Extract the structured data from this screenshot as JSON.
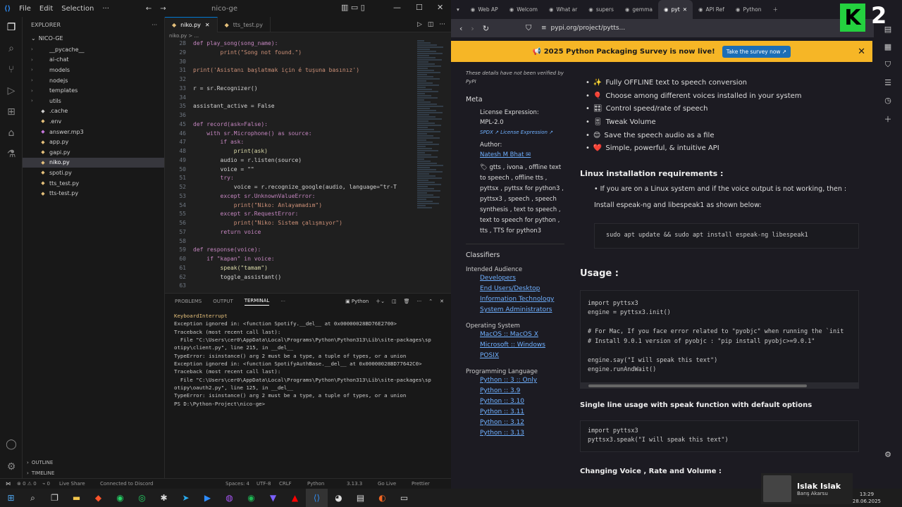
{
  "vscode": {
    "menu": [
      "File",
      "Edit",
      "Selection"
    ],
    "title": "nico-ge",
    "explorer_label": "EXPLORER",
    "folder": "NICO-GE",
    "files": [
      {
        "name": "__pycache__",
        "type": "folder",
        "color": "#ccc"
      },
      {
        "name": "ai-chat",
        "type": "folder",
        "color": "#ccc"
      },
      {
        "name": "models",
        "type": "folder",
        "color": "#ccc"
      },
      {
        "name": "nodejs",
        "type": "folder",
        "color": "#ccc"
      },
      {
        "name": "templates",
        "type": "folder",
        "color": "#ccc"
      },
      {
        "name": "utils",
        "type": "folder",
        "color": "#ccc"
      },
      {
        "name": ".cache",
        "type": "file",
        "color": "#ccc"
      },
      {
        "name": ".env",
        "type": "file",
        "color": "#e5c07b"
      },
      {
        "name": "answer.mp3",
        "type": "file",
        "color": "#c678dd"
      },
      {
        "name": "app.py",
        "type": "file",
        "color": "#e5c07b"
      },
      {
        "name": "gapi.py",
        "type": "file",
        "color": "#e5c07b"
      },
      {
        "name": "niko.py",
        "type": "file",
        "color": "#e5c07b",
        "selected": true
      },
      {
        "name": "spoti.py",
        "type": "file",
        "color": "#e5c07b"
      },
      {
        "name": "tts_test.py",
        "type": "file",
        "color": "#e5c07b"
      },
      {
        "name": "tts-test.py",
        "type": "file",
        "color": "#e5c07b"
      }
    ],
    "outline": "OUTLINE",
    "timeline": "TIMELINE",
    "tabs": [
      {
        "label": "niko.py",
        "active": true
      },
      {
        "label": "tts_test.py",
        "active": false
      }
    ],
    "breadcrumb": "niko.py > ...",
    "code": [
      {
        "n": "28",
        "t": "def play_song(song_name):"
      },
      {
        "n": "29",
        "t": "        print(\"Song not found.\")"
      },
      {
        "n": "30",
        "t": ""
      },
      {
        "n": "31",
        "t": "print('Asistanı başlatmak için é tuşuna basınız')"
      },
      {
        "n": "32",
        "t": ""
      },
      {
        "n": "33",
        "t": "r = sr.Recognizer()"
      },
      {
        "n": "34",
        "t": ""
      },
      {
        "n": "35",
        "t": "assistant_active = False"
      },
      {
        "n": "36",
        "t": ""
      },
      {
        "n": "45",
        "t": "def record(ask=False):"
      },
      {
        "n": "46",
        "t": "    with sr.Microphone() as source:"
      },
      {
        "n": "47",
        "t": "        if ask:"
      },
      {
        "n": "48",
        "t": "            print(ask)"
      },
      {
        "n": "49",
        "t": "        audio = r.listen(source)"
      },
      {
        "n": "50",
        "t": "        voice = \"\""
      },
      {
        "n": "51",
        "t": "        try:"
      },
      {
        "n": "52",
        "t": "            voice = r.recognize_google(audio, language=\"tr-T"
      },
      {
        "n": "53",
        "t": "        except sr.UnknownValueError:"
      },
      {
        "n": "54",
        "t": "            print(\"Niko: Anlayamadım\")"
      },
      {
        "n": "55",
        "t": "        except sr.RequestError:"
      },
      {
        "n": "56",
        "t": "            print(\"Niko: Sistem çalışmıyor\")"
      },
      {
        "n": "57",
        "t": "        return voice"
      },
      {
        "n": "58",
        "t": ""
      },
      {
        "n": "59",
        "t": "def response(voice):"
      },
      {
        "n": "60",
        "t": "    if \"kapan\" in voice:"
      },
      {
        "n": "61",
        "t": "        speak(\"tamam\")"
      },
      {
        "n": "62",
        "t": "        toggle_assistant()"
      },
      {
        "n": "63",
        "t": ""
      }
    ],
    "panel_tabs": [
      "PROBLEMS",
      "OUTPUT",
      "TERMINAL"
    ],
    "panel_right": "Python",
    "terminal": [
      {
        "t": "KeyboardInterrupt",
        "c": "yellow"
      },
      {
        "t": "Exception ignored in: <function Spotify.__del__ at 0x00000028BD76E2700>"
      },
      {
        "t": "Traceback (most recent call last):"
      },
      {
        "t": "  File \"C:\\Users\\cer0\\AppData\\Local\\Programs\\Python\\Python313\\Lib\\site-packages\\sp"
      },
      {
        "t": "otipy\\client.py\", line 215, in __del__"
      },
      {
        "t": "TypeError: isinstance() arg 2 must be a type, a tuple of types, or a union"
      },
      {
        "t": "Exception ignored in: <function SpotifyAuthBase.__del__ at 0x00000028BD77642C0>"
      },
      {
        "t": "Traceback (most recent call last):"
      },
      {
        "t": "  File \"C:\\Users\\cer0\\AppData\\Local\\Programs\\Python\\Python313\\Lib\\site-packages\\sp"
      },
      {
        "t": "otipy\\oauth2.py\", line 125, in __del__"
      },
      {
        "t": "TypeError: isinstance() arg 2 must be a type, a tuple of types, or a union"
      },
      {
        "t": "PS D:\\Python-Project\\nico-ge> "
      }
    ],
    "status": {
      "errors": "⊗ 0 ⚠ 0",
      "warnings": "⚠ 0",
      "liveshare": "Live Share",
      "discord": "Connected to Discord",
      "spaces": "Spaces: 4",
      "encoding": "UTF-8",
      "eol": "CRLF",
      "lang": "Python",
      "version": "3.13.3",
      "golive": "Go Live",
      "prettier": "Prettier"
    }
  },
  "browser": {
    "tabs": [
      {
        "label": "Web AP",
        "active": false
      },
      {
        "label": "Welcom",
        "active": false
      },
      {
        "label": "What ar",
        "active": false
      },
      {
        "label": "supers",
        "active": false
      },
      {
        "label": "gemma",
        "active": false
      },
      {
        "label": "pyt",
        "active": true
      },
      {
        "label": "API Ref",
        "active": false
      },
      {
        "label": "Python",
        "active": false
      }
    ],
    "url": "pypi.org/project/pytts...",
    "survey": {
      "text": "📢 2025 Python Packaging Survey is now live!",
      "button": "Take the survey now ↗"
    },
    "left": {
      "note": "These details have not been verified by PyPI",
      "meta_heading": "Meta",
      "license_label": "License Expression:",
      "license_value": "MPL-2.0",
      "spdx": "SPDX ↗  License Expression ↗",
      "author_label": "Author:",
      "author_value": "Natesh M Bhat ✉",
      "tags": "🏷 gtts , ivona , offline text to speech , offline tts , pyttsx , pyttsx for python3 , pyttsx3 , speech , speech synthesis , text to speech , text to speech for python , tts , TTS for python3",
      "classifiers": "Classifiers",
      "audience_label": "Intended Audience",
      "audience": [
        "Developers",
        "End Users/Desktop",
        "Information Technology",
        "System Administrators"
      ],
      "os_label": "Operating System",
      "os": [
        "MacOS :: MacOS X",
        "Microsoft :: Windows",
        "POSIX"
      ],
      "lang_label": "Programming Language",
      "langs": [
        "Python :: 3 :: Only",
        "Python :: 3.9",
        "Python :: 3.10",
        "Python :: 3.11",
        "Python :: 3.12",
        "Python :: 3.13"
      ]
    },
    "right": {
      "features": [
        {
          "icon": "✨",
          "text": "Fully OFFLINE text to speech conversion"
        },
        {
          "icon": "🎈",
          "text": "Choose among different voices installed in your system"
        },
        {
          "icon": "🎛",
          "text": "Control speed/rate of speech"
        },
        {
          "icon": "🎚",
          "text": "Tweak Volume"
        },
        {
          "icon": "😊",
          "text": "Save the speech audio as a file"
        },
        {
          "icon": "❤️",
          "text": "Simple, powerful, & intuitive API"
        }
      ],
      "linux_heading": "Linux installation requirements :",
      "linux_bullet": "If you are on a Linux system and if the voice output is not working, then :",
      "linux_install": "Install espeak-ng and libespeak1 as shown below:",
      "linux_code": "sudo apt update && sudo apt install espeak-ng libespeak1",
      "usage_heading": "Usage :",
      "usage_code": "import pyttsx3\nengine = pyttsx3.init()\n\n# For Mac, If you face error related to \"pyobjc\" when running the `init\n# Install 9.0.1 version of pyobjc : \"pip install pyobjc>=9.0.1\"\n\nengine.say(\"I will speak this text\")\nengine.runAndWait()",
      "single_heading": "Single line usage with speak function with default options",
      "single_code": "import pyttsx3\npyttsx3.speak(\"I will speak this text\")",
      "next_heading": "Changing Voice , Rate and Volume :"
    }
  },
  "overlay": {
    "k": "K",
    "two": "2"
  },
  "music": {
    "title": "Islak Islak",
    "artist": "Barış Akarsu"
  },
  "clock": {
    "time": "13:29",
    "date": "28.06.2025"
  }
}
